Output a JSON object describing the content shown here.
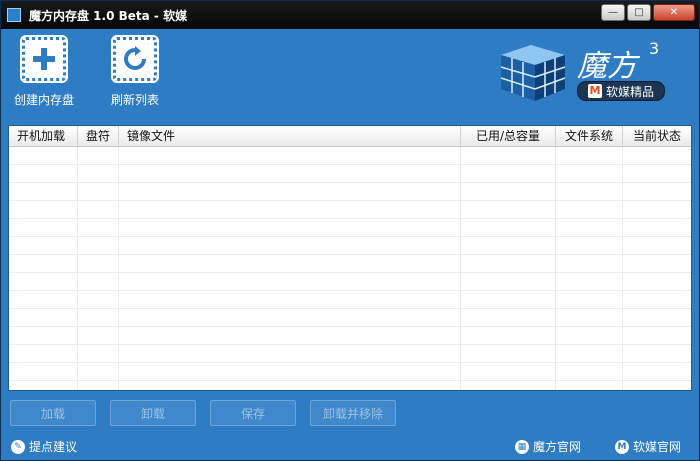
{
  "window": {
    "title": "魔方内存盘 1.0 Beta - 软媒",
    "minimize_glyph": "—",
    "maximize_glyph": "□",
    "close_glyph": "✕"
  },
  "toolbar": {
    "create_label": "创建内存盘",
    "refresh_label": "刷新列表"
  },
  "logo": {
    "brand": "魔方",
    "version_sup": "3",
    "badge_letter": "M",
    "badge_text": "软媒精品"
  },
  "table": {
    "columns": [
      "开机加载",
      "盘符",
      "镜像文件",
      "已用/总容量",
      "文件系统",
      "当前状态"
    ]
  },
  "actions": {
    "load": "加载",
    "unload": "卸载",
    "save": "保存",
    "unload_remove": "卸载并移除"
  },
  "footer": {
    "feedback": "提点建议",
    "mofang_site": "魔方官网",
    "ruanmei_site": "软媒官网"
  },
  "colors": {
    "window_bg": "#2e7dc4",
    "titlebar": "#0a0a0a",
    "close_btn": "#c8432c"
  }
}
